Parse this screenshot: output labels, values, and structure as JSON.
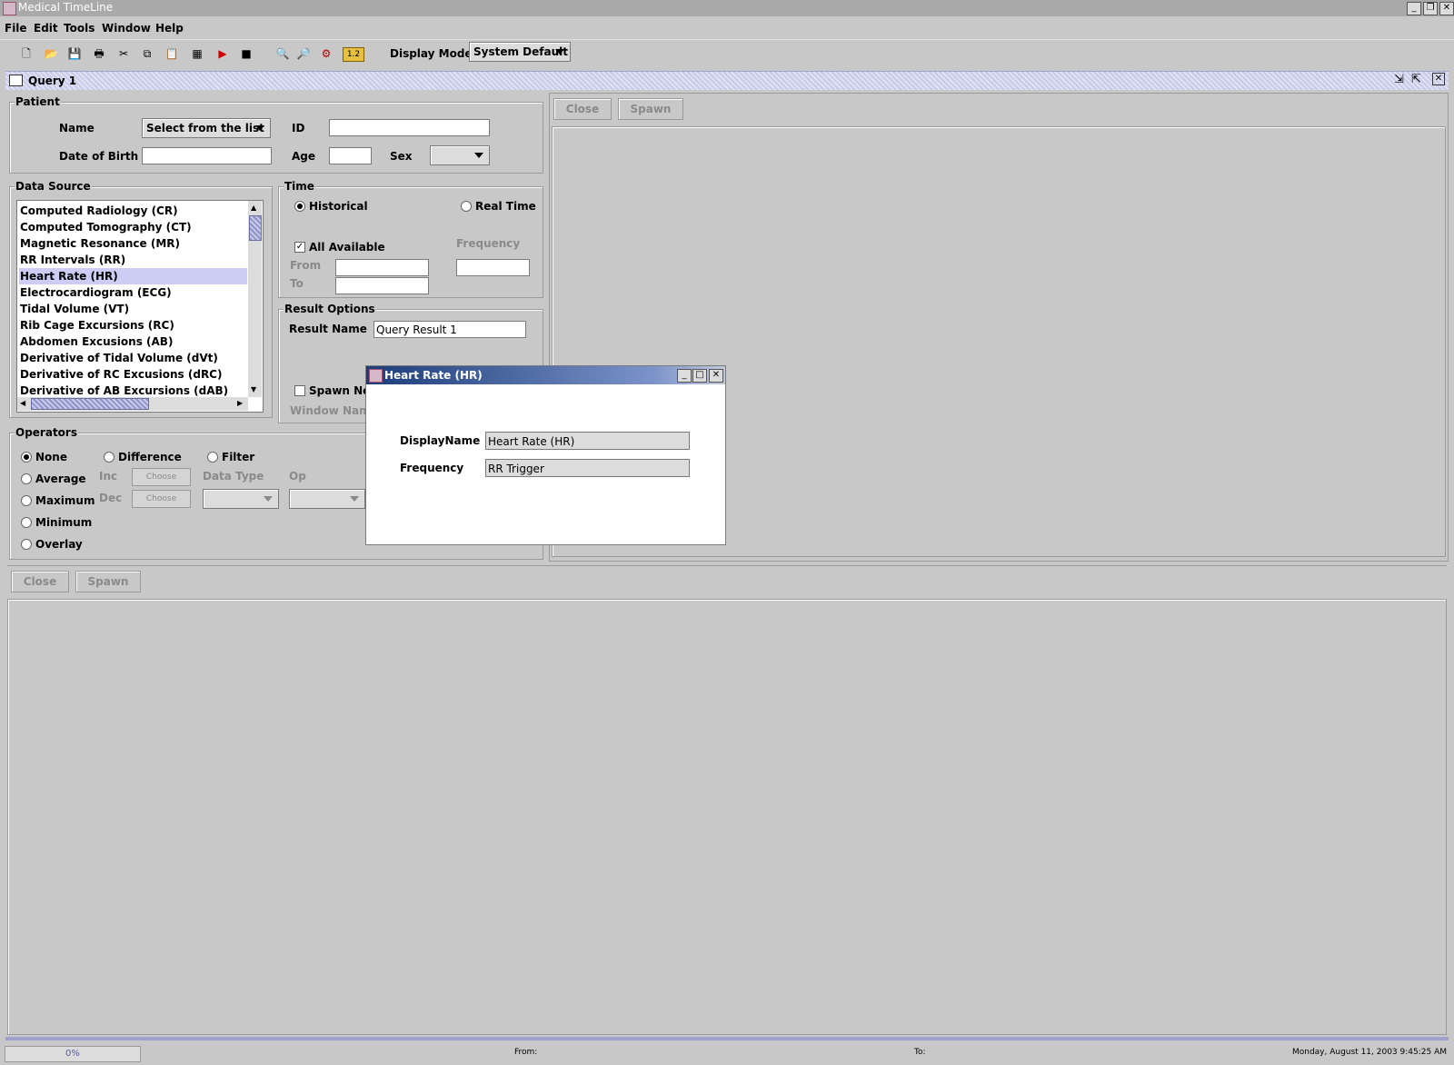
{
  "window": {
    "title": "Medical TimeLine"
  },
  "menu": [
    "File",
    "Edit",
    "Tools",
    "Window",
    "Help"
  ],
  "toolbar": {
    "icons": [
      "new-icon",
      "open-icon",
      "save-icon",
      "print-icon",
      "cut-icon",
      "copy-icon",
      "paste-icon",
      "table-icon",
      "play-icon",
      "stop-icon",
      "zoom-in-icon",
      "zoom-out-icon",
      "settings-icon",
      "chart-icon"
    ],
    "display_mode_label": "Display Mode",
    "display_mode_value": "System Default"
  },
  "query": {
    "title": "Query 1"
  },
  "patient": {
    "legend": "Patient",
    "name_label": "Name",
    "name_value": "Select from the list",
    "id_label": "ID",
    "dob_label": "Date of Birth",
    "age_label": "Age",
    "sex_label": "Sex"
  },
  "data_source": {
    "legend": "Data Source",
    "items": [
      "Computed Radiology (CR)",
      "Computed Tomography (CT)",
      "Magnetic Resonance (MR)",
      "RR Intervals (RR)",
      "Heart Rate (HR)",
      "Electrocardiogram (ECG)",
      "Tidal Volume (VT)",
      "Rib Cage Excursions (RC)",
      "Abdomen Excusions (AB)",
      "Derivative of Tidal Volume (dVt)",
      "Derivative of RC Excusions (dRC)",
      "Derivative of AB Excursions (dAB)"
    ],
    "selected": "Heart Rate (HR)"
  },
  "time": {
    "legend": "Time",
    "historical": "Historical",
    "real_time": "Real Time",
    "all_available": "All Available",
    "frequency": "Frequency",
    "from": "From",
    "to": "To"
  },
  "result_options": {
    "legend": "Result Options",
    "result_name_label": "Result Name",
    "result_name_value": "Query Result 1",
    "spawn_new": "Spawn New",
    "window_name": "Window Name"
  },
  "operators": {
    "legend": "Operators",
    "none": "None",
    "average": "Average",
    "maximum": "Maximum",
    "minimum": "Minimum",
    "overlay": "Overlay",
    "difference": "Difference",
    "filter": "Filter",
    "inc": "Inc",
    "dec": "Dec",
    "choose": "Choose",
    "data_type": "Data Type",
    "op": "Op"
  },
  "buttons": {
    "close": "Close",
    "spawn": "Spawn"
  },
  "dialog": {
    "title": "Heart Rate (HR)",
    "display_name_label": "DisplayName",
    "display_name_value": "Heart Rate (HR)",
    "frequency_label": "Frequency",
    "frequency_value": "RR Trigger"
  },
  "status": {
    "progress": "0%",
    "progress_fraction": 0,
    "from": "From:",
    "to": "To:",
    "datetime": "Monday, August 11, 2003 9:45:25 AM"
  }
}
